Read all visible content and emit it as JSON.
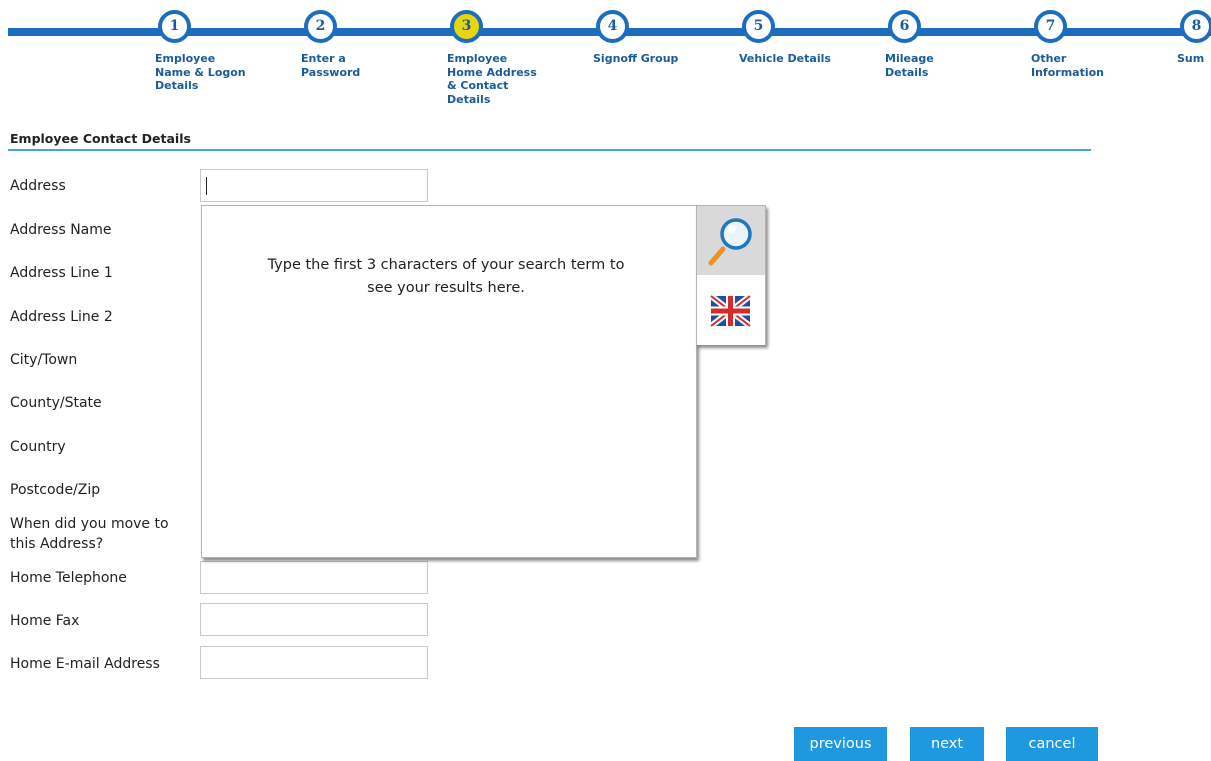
{
  "wizard": {
    "steps": [
      {
        "number": "1",
        "label": "Employee\nName & Logon\nDetails"
      },
      {
        "number": "2",
        "label": "Enter a\nPassword"
      },
      {
        "number": "3",
        "label": "Employee\nHome Address\n& Contact\nDetails",
        "active": true
      },
      {
        "number": "4",
        "label": "Signoff Group"
      },
      {
        "number": "5",
        "label": "Vehicle Details"
      },
      {
        "number": "6",
        "label": "Mileage\nDetails"
      },
      {
        "number": "7",
        "label": "Other\nInformation"
      },
      {
        "number": "8",
        "label": "Sum"
      }
    ],
    "accent": "#1b6dbf",
    "active_color": "#e5d60f"
  },
  "section": {
    "title": "Employee Contact Details"
  },
  "form": {
    "address": {
      "label": "Address",
      "value": ""
    },
    "address_name": {
      "label": "Address Name"
    },
    "address_line1": {
      "label": "Address Line 1"
    },
    "address_line2": {
      "label": "Address Line 2"
    },
    "city": {
      "label": "City/Town"
    },
    "county": {
      "label": "County/State"
    },
    "country": {
      "label": "Country"
    },
    "postcode": {
      "label": "Postcode/Zip"
    },
    "move_date": {
      "label": "When did you move to this Address?"
    },
    "home_telephone": {
      "label": "Home Telephone",
      "value": ""
    },
    "home_fax": {
      "label": "Home Fax",
      "value": ""
    },
    "home_email": {
      "label": "Home E-mail Address",
      "value": ""
    }
  },
  "address_lookup": {
    "message": "Type the first 3 characters of your search term to\nsee your results here.",
    "search_icon": "magnifier-icon",
    "country_icon": "uk-flag-icon"
  },
  "buttons": {
    "previous": "previous",
    "next": "next",
    "cancel": "cancel",
    "color": "#1e98de"
  }
}
